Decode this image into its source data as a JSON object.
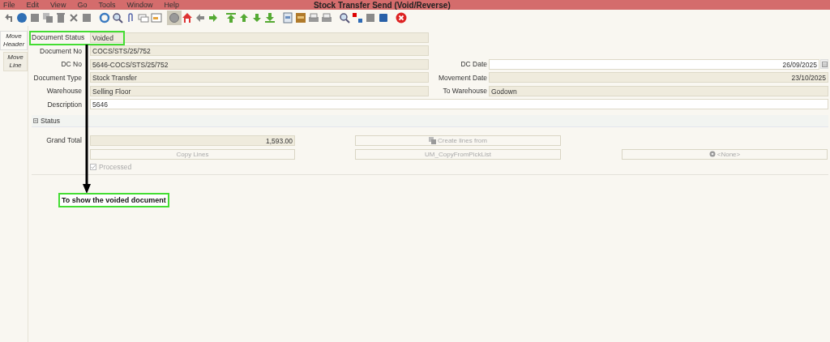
{
  "window": {
    "title": "Stock Transfer Send (Void/Reverse)"
  },
  "menu": [
    "File",
    "Edit",
    "View",
    "Go",
    "Tools",
    "Window",
    "Help"
  ],
  "side_tabs": [
    {
      "label": "Move Header",
      "selected": true
    },
    {
      "label": "Move Line",
      "selected": false
    }
  ],
  "header_rows": [
    {
      "left": {
        "label": "Document Status",
        "value": "Voided",
        "read_only": true,
        "highlighted": true
      }
    },
    {
      "left": {
        "label": "Document No",
        "value": "COCS/STS/25/752",
        "read_only": true
      }
    },
    {
      "left": {
        "label": "DC No",
        "value": "5646-COCS/STS/25/752",
        "read_only": true
      },
      "right": {
        "label": "DC Date",
        "value": "26/09/2025",
        "read_only": false,
        "kind": "date"
      }
    },
    {
      "left": {
        "label": "Document Type",
        "value": "Stock Transfer",
        "read_only": true
      },
      "right": {
        "label": "Movement Date",
        "value": "23/10/2025",
        "read_only": true,
        "kind": "date"
      }
    },
    {
      "left": {
        "label": "Warehouse",
        "value": "Selling Floor",
        "read_only": true
      },
      "right": {
        "label": "To Warehouse",
        "value": "Godown",
        "read_only": true,
        "kind": "text"
      }
    },
    {
      "wide": true,
      "left": {
        "label": "Description",
        "value": "5646",
        "read_only": false
      }
    }
  ],
  "status_section": {
    "title": "Status",
    "expanded": true,
    "grand_total": {
      "label": "Grand Total",
      "value": "1,593.00"
    },
    "buttons": [
      {
        "label": "Create lines from",
        "kind": "copy",
        "disabled": true
      },
      {
        "label": "Copy Lines",
        "kind": "plain",
        "disabled": true
      },
      {
        "label": "UM_CopyFromPickList",
        "kind": "plain",
        "disabled": true
      },
      {
        "label": "<None>",
        "kind": "gear",
        "disabled": true
      }
    ],
    "processed": {
      "label": "Processed",
      "checked": true,
      "disabled": true
    }
  },
  "annotation": {
    "text": "To show the voided document"
  }
}
